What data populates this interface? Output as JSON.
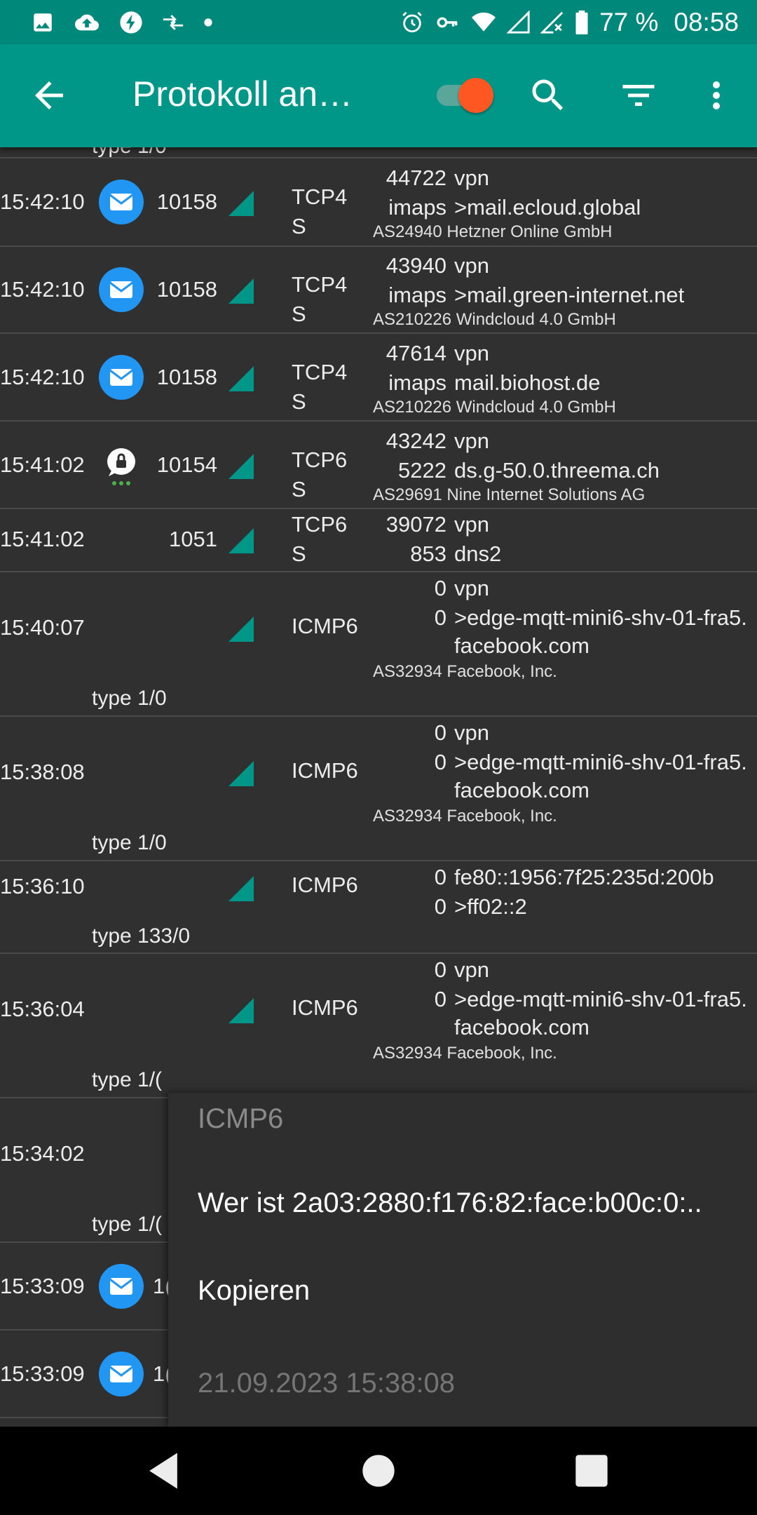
{
  "status_bar": {
    "battery": "77 %",
    "time": "08:58",
    "icons": [
      "image-icon",
      "cloud-upload-icon",
      "flash-icon",
      "data-transfer-icon",
      "dot-icon",
      "alarm-icon",
      "vpn-key-icon",
      "wifi-icon",
      "signal-icon",
      "signal-x-icon",
      "battery-icon"
    ]
  },
  "app_bar": {
    "title": "Protokoll an…",
    "toggle_on": true,
    "icons": [
      "back-arrow-icon",
      "search-icon",
      "filter-icon",
      "more-vert-icon"
    ]
  },
  "colors": {
    "status_bar": "#00897b",
    "app_bar": "#009688",
    "accent": "#ff5722",
    "background": "#303030",
    "mail_icon": "#2196f3"
  },
  "log": {
    "partial_top": {
      "type": "type 1/0"
    },
    "rows": [
      {
        "time": "15:42:10",
        "icon": "mail-icon",
        "uid": "10158",
        "proto1": "TCP4",
        "proto2": "S",
        "port1": "44722",
        "dest1": "vpn",
        "port2": "imaps",
        "dest2": ">mail.ecloud.global",
        "dest3": "",
        "asn": "AS24940 Hetzner Online GmbH",
        "type": ""
      },
      {
        "time": "15:42:10",
        "icon": "mail-icon",
        "uid": "10158",
        "proto1": "TCP4",
        "proto2": "S",
        "port1": "43940",
        "dest1": "vpn",
        "port2": "imaps",
        "dest2": ">mail.green-internet.net",
        "dest3": "",
        "asn": "AS210226 Windcloud 4.0 GmbH",
        "type": ""
      },
      {
        "time": "15:42:10",
        "icon": "mail-icon",
        "uid": "10158",
        "proto1": "TCP4",
        "proto2": "S",
        "port1": "47614",
        "dest1": "vpn",
        "port2": "imaps",
        "dest2": "mail.biohost.de",
        "dest3": "",
        "asn": "AS210226 Windcloud 4.0 GmbH",
        "type": ""
      },
      {
        "time": "15:41:02",
        "icon": "threema-icon",
        "uid": "10154",
        "proto1": "TCP6",
        "proto2": "S",
        "port1": "43242",
        "dest1": "vpn",
        "port2": "5222",
        "dest2": "ds.g-50.0.threema.ch",
        "dest3": "",
        "asn": "AS29691 Nine Internet Solutions AG",
        "type": ""
      },
      {
        "time": "15:41:02",
        "icon": "",
        "uid": "1051",
        "proto1": "TCP6",
        "proto2": "S",
        "port1": "39072",
        "dest1": "vpn",
        "port2": "853",
        "dest2": "dns2",
        "dest3": "",
        "asn": "",
        "type": ""
      },
      {
        "time": "15:40:07",
        "icon": "",
        "uid": "",
        "proto1": "ICMP6",
        "proto2": "",
        "port1": "0",
        "dest1": "vpn",
        "port2": "0",
        "dest2": ">edge-mqtt-mini6-shv-01-fra5.",
        "dest3": "facebook.com",
        "asn": "AS32934 Facebook, Inc.",
        "type": "type 1/0"
      },
      {
        "time": "15:38:08",
        "icon": "",
        "uid": "",
        "proto1": "ICMP6",
        "proto2": "",
        "port1": "0",
        "dest1": "vpn",
        "port2": "0",
        "dest2": ">edge-mqtt-mini6-shv-01-fra5.",
        "dest3": "facebook.com",
        "asn": "AS32934 Facebook, Inc.",
        "type": "type 1/0"
      },
      {
        "time": "15:36:10",
        "icon": "",
        "uid": "",
        "proto1": "ICMP6",
        "proto2": "",
        "port1": "0",
        "dest1": "fe80::1956:7f25:235d:200b",
        "port2": "0",
        "dest2": ">ff02::2",
        "dest3": "",
        "asn": "",
        "type": "type 133/0"
      },
      {
        "time": "15:36:04",
        "icon": "",
        "uid": "",
        "proto1": "ICMP6",
        "proto2": "",
        "port1": "0",
        "dest1": "vpn",
        "port2": "0",
        "dest2": ">edge-mqtt-mini6-shv-01-fra5.",
        "dest3": "facebook.com",
        "asn": "AS32934 Facebook, Inc.",
        "type": "type 1/("
      },
      {
        "time": "15:34:02",
        "icon": "",
        "uid": "",
        "proto1": "",
        "proto2": "",
        "port1": "",
        "dest1": "",
        "port2": "",
        "dest2": "",
        "dest3": "",
        "asn": "",
        "type": "type 1/("
      },
      {
        "time": "15:33:09",
        "icon": "mail-icon",
        "uid": "1(",
        "proto1": "",
        "proto2": "",
        "port1": "",
        "dest1": "",
        "port2": "",
        "dest2": "",
        "dest3": "",
        "asn": "",
        "type": ""
      },
      {
        "time": "15:33:09",
        "icon": "mail-icon",
        "uid": "1(",
        "proto1": "",
        "proto2": "",
        "port1": "",
        "dest1": "",
        "port2": "",
        "dest2": "",
        "dest3": "",
        "asn": "",
        "type": ""
      }
    ]
  },
  "popup": {
    "header": "ICMP6",
    "item_whois": "Wer ist 2a03:2880:f176:82:face:b00c:0:..",
    "item_copy": "Kopieren",
    "footer": "21.09.2023 15:38:08"
  },
  "nav_bar": {
    "icons": [
      "back-triangle-icon",
      "home-circle-icon",
      "recents-square-icon"
    ]
  }
}
